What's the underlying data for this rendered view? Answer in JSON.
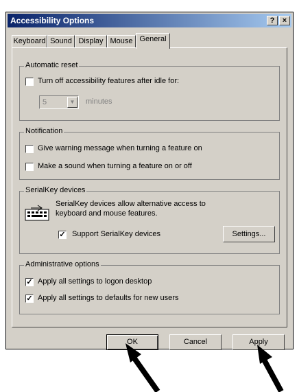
{
  "window": {
    "title": "Accessibility Options",
    "help_label": "?",
    "close_label": "×"
  },
  "tabs": [
    {
      "label": "Keyboard"
    },
    {
      "label": "Sound"
    },
    {
      "label": "Display"
    },
    {
      "label": "Mouse"
    },
    {
      "label": "General",
      "active": true
    }
  ],
  "automatic_reset": {
    "title": "Automatic reset",
    "checkbox_label": "Turn off accessibility features after idle for:",
    "checked": false,
    "idle_value": "5",
    "unit_label": "minutes"
  },
  "notification": {
    "title": "Notification",
    "warning_label": "Give warning message when turning a feature on",
    "warning_checked": false,
    "sound_label": "Make a sound when turning a feature on or off",
    "sound_checked": false
  },
  "serialkey": {
    "title": "SerialKey devices",
    "description_line1": "SerialKey devices allow alternative access to",
    "description_line2": "keyboard and mouse features.",
    "support_label": "Support SerialKey devices",
    "support_checked": true,
    "settings_button": "Settings..."
  },
  "admin": {
    "title": "Administrative options",
    "logon_label": "Apply all settings to logon desktop",
    "logon_checked": true,
    "defaults_label": "Apply all settings to defaults for new users",
    "defaults_checked": true
  },
  "buttons": {
    "ok": "OK",
    "cancel": "Cancel",
    "apply": "Apply"
  },
  "check_mark": "✓",
  "colors": {
    "title_bar_start": "#0a246a",
    "title_bar_end": "#a6caf0",
    "face": "#d4d0c8"
  }
}
